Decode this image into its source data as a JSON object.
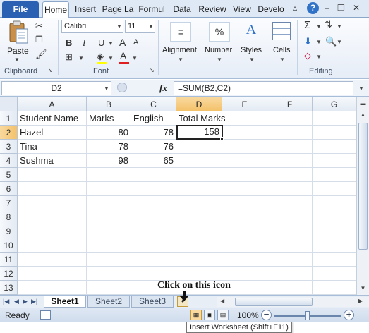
{
  "ribbon_tabs": {
    "file": "File",
    "items": [
      "Home",
      "Insert",
      "Page La",
      "Formul",
      "Data",
      "Review",
      "View",
      "Develo"
    ],
    "active": "Home"
  },
  "clipboard": {
    "paste_label": "Paste",
    "group_label": "Clipboard"
  },
  "font": {
    "family": "Calibri",
    "size": "11",
    "group_label": "Font",
    "bold": "B",
    "italic": "I",
    "underline": "U"
  },
  "alignment": {
    "label": "Alignment"
  },
  "number": {
    "label": "Number",
    "icon_text": "%"
  },
  "styles": {
    "label": "Styles"
  },
  "cells": {
    "label": "Cells"
  },
  "editing": {
    "group_label": "Editing",
    "sum_icon": "Σ"
  },
  "formula_bar": {
    "name_box": "D2",
    "fx": "fx",
    "formula": "=SUM(B2,C2)"
  },
  "columns": [
    "A",
    "B",
    "C",
    "D",
    "E",
    "F",
    "G"
  ],
  "rows": [
    "1",
    "2",
    "3",
    "4",
    "5",
    "6",
    "7",
    "8",
    "9",
    "10",
    "11",
    "12",
    "13"
  ],
  "cells_data": {
    "A1": "Student Name",
    "B1": "Marks",
    "C1": "English",
    "D1": "Total Marks",
    "A2": "Hazel",
    "B2": "80",
    "C2": "78",
    "D2": "158",
    "A3": "Tina",
    "B3": "78",
    "C3": "76",
    "A4": "Sushma",
    "B4": "98",
    "C4": "65"
  },
  "sheets": [
    "Sheet1",
    "Sheet2",
    "Sheet3"
  ],
  "active_sheet": "Sheet1",
  "annotation": "Click on this icon",
  "status": {
    "ready": "Ready",
    "zoom": "100%"
  },
  "tooltip": "Insert Worksheet (Shift+F11)",
  "colors": {
    "file_tab": "#2a61b3",
    "selection_header": "#f3c26a",
    "ribbon_bg": "#e6edf7"
  }
}
